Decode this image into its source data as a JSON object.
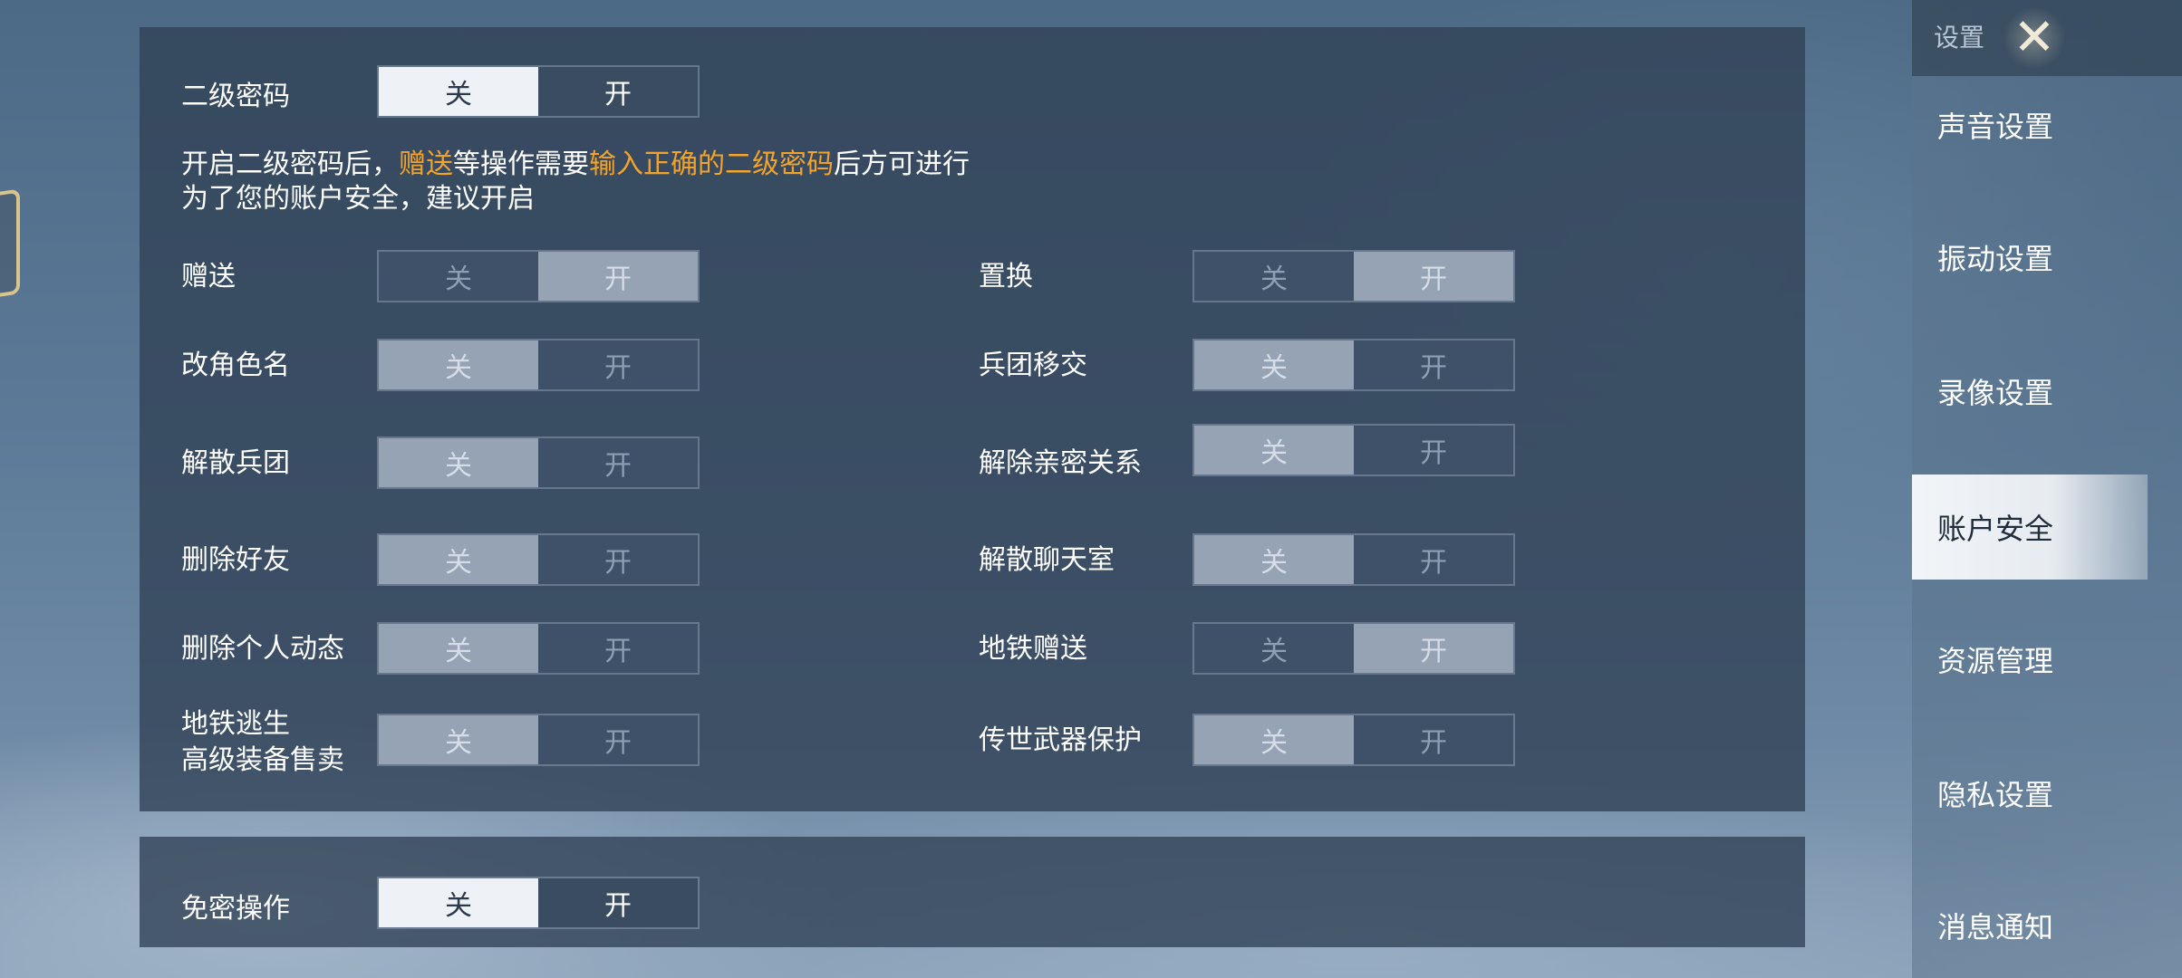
{
  "security_panel": {
    "master": {
      "label": "二级密码",
      "off_label": "关",
      "on_label": "开"
    },
    "description": {
      "line1_part1": "开启二级密码后，",
      "line1_highlight1": "赠送",
      "line1_part2": "等操作需要",
      "line1_highlight2": "输入正确的二级密码",
      "line1_part3": "后方可进行",
      "line2": "为了您的账户安全，建议开启"
    },
    "options_left": [
      {
        "label": "赠送",
        "off": "关",
        "on": "开"
      },
      {
        "label": "改角色名",
        "off": "关",
        "on": "开"
      },
      {
        "label": "解散兵团",
        "off": "关",
        "on": "开"
      },
      {
        "label": "删除好友",
        "off": "关",
        "on": "开"
      },
      {
        "label": "删除个人动态",
        "off": "关",
        "on": "开"
      },
      {
        "label_line1": "地铁逃生",
        "label_line2": "高级装备售卖",
        "off": "关",
        "on": "开"
      }
    ],
    "options_right": [
      {
        "label": "置换",
        "off": "关",
        "on": "开"
      },
      {
        "label": "兵团移交",
        "off": "关",
        "on": "开"
      },
      {
        "label": "解除亲密关系",
        "off": "关",
        "on": "开"
      },
      {
        "label": "解散聊天室",
        "off": "关",
        "on": "开"
      },
      {
        "label": "地铁赠送",
        "off": "关",
        "on": "开"
      },
      {
        "label": "传世武器保护",
        "off": "关",
        "on": "开"
      }
    ]
  },
  "password_free": {
    "label": "免密操作",
    "off_label": "关",
    "on_label": "开"
  },
  "sidebar": {
    "title": "设置",
    "close_icon": "close-icon",
    "items": [
      {
        "label": "声音设置"
      },
      {
        "label": "振动设置"
      },
      {
        "label": "录像设置"
      },
      {
        "label": "账户安全"
      },
      {
        "label": "资源管理"
      },
      {
        "label": "隐私设置"
      },
      {
        "label": "消息通知"
      }
    ],
    "active_index": 3
  },
  "colors": {
    "highlight": "#f3a428",
    "panel": "#304054",
    "active_tab": "#f2f5f8"
  }
}
